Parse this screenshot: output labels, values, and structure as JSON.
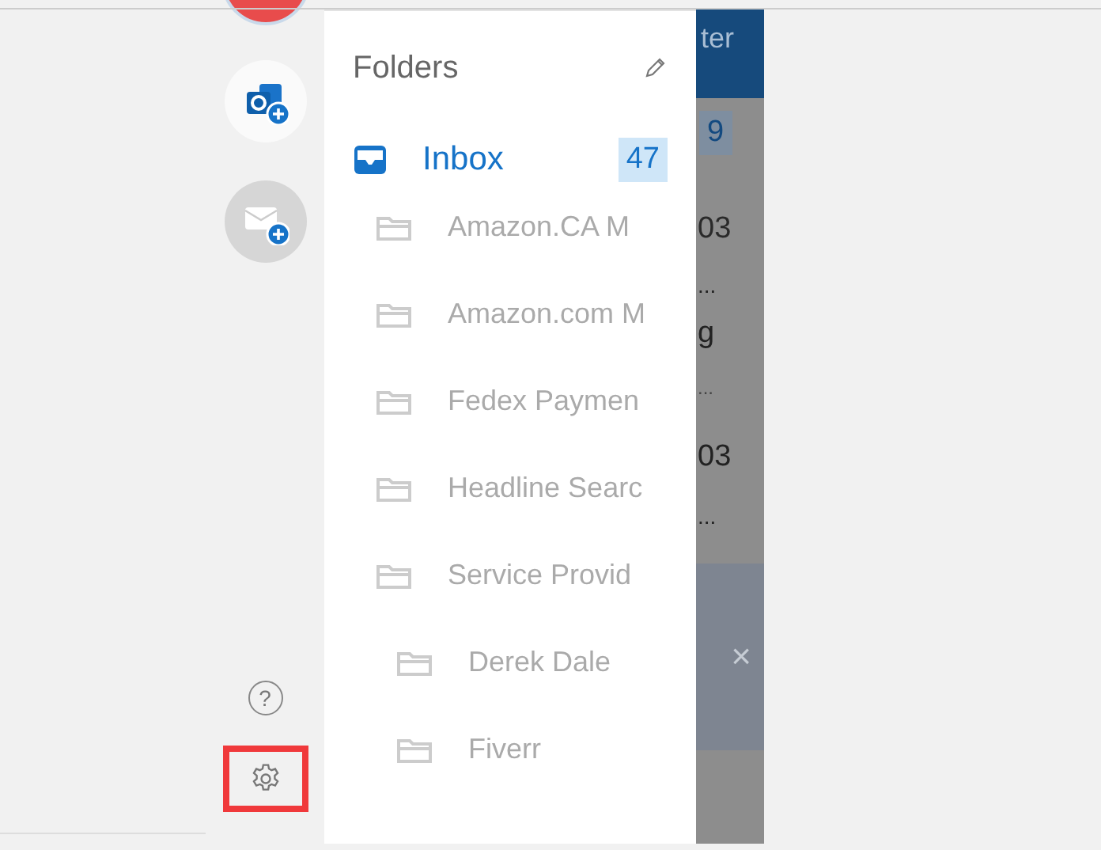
{
  "accounts_bar": {
    "accounts": [
      {
        "kind": "avatar"
      },
      {
        "kind": "outlook"
      },
      {
        "kind": "mail"
      }
    ],
    "help_button": "?",
    "settings": {
      "highlighted": true
    }
  },
  "folders_pane": {
    "title": "Folders",
    "inbox": {
      "label": "Inbox",
      "count": "47",
      "selected": true
    },
    "folders": [
      {
        "label": "Amazon.CA M"
      },
      {
        "label": "Amazon.com M"
      },
      {
        "label": "Fedex Paymen"
      },
      {
        "label": "Headline Searc"
      },
      {
        "label": "Service Provid",
        "children": [
          {
            "label": "Derek Dale"
          },
          {
            "label": "Fiverr"
          }
        ]
      }
    ]
  },
  "message_list": {
    "header": "ter",
    "badge": "9",
    "texts": [
      "03",
      "...",
      "g",
      "...",
      "03",
      "..."
    ],
    "close": "×"
  }
}
